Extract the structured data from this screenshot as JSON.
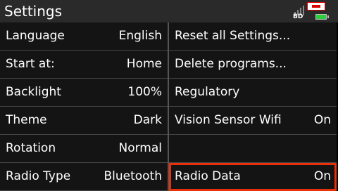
{
  "header": {
    "title": "Settings",
    "radio_label": "BD",
    "icons": [
      "signal-bars-icon",
      "vex-logo-icon",
      "battery-icon"
    ],
    "battery_color": "#2ecc40"
  },
  "left_column": [
    {
      "label": "Language",
      "value": "English"
    },
    {
      "label": "Start at:",
      "value": "Home"
    },
    {
      "label": "Backlight",
      "value": "100%"
    },
    {
      "label": "Theme",
      "value": "Dark"
    },
    {
      "label": "Rotation",
      "value": "Normal"
    },
    {
      "label": "Radio Type",
      "value": "Bluetooth"
    }
  ],
  "right_column": [
    {
      "label": "Reset all Settings...",
      "value": ""
    },
    {
      "label": "Delete programs...",
      "value": ""
    },
    {
      "label": "Regulatory",
      "value": ""
    },
    {
      "label": "Vision Sensor Wifi",
      "value": "On"
    },
    {
      "label": "",
      "value": ""
    },
    {
      "label": "Radio Data",
      "value": "On",
      "selected": true
    }
  ],
  "colors": {
    "selection_outline": "#e8300b",
    "titlebar": "#2a2a2a",
    "row_background": "#141414"
  }
}
